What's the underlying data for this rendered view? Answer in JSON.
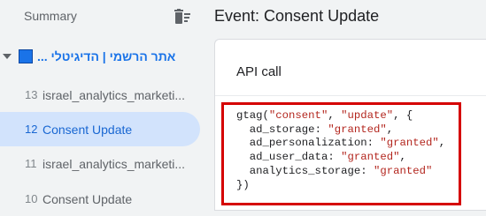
{
  "sidebar": {
    "summary_label": "Summary",
    "container_name": "אתר הרשמי | הדיגיטלי ...",
    "container_color": "#1a73e8",
    "events": [
      {
        "num": "13",
        "name": "israel_analytics_marketi...",
        "selected": false
      },
      {
        "num": "12",
        "name": "Consent Update",
        "selected": true
      },
      {
        "num": "11",
        "name": "israel_analytics_marketi...",
        "selected": false
      },
      {
        "num": "10",
        "name": "Consent Update",
        "selected": false
      }
    ]
  },
  "main": {
    "title": "Event: Consent Update",
    "card_title": "API call",
    "code": {
      "fn": "gtag(",
      "arg1": "\"consent\"",
      "arg2": "\"update\"",
      "open": ", {",
      "params": [
        {
          "key": "ad_storage",
          "value": "\"granted\""
        },
        {
          "key": "ad_personalization",
          "value": "\"granted\""
        },
        {
          "key": "ad_user_data",
          "value": "\"granted\""
        },
        {
          "key": "analytics_storage",
          "value": "\"granted\""
        }
      ],
      "close": "})"
    }
  },
  "colors": {
    "accent": "#1a73e8",
    "highlight_border": "#d50000",
    "string": "#b3261e",
    "selected_bg": "#d2e3fc"
  },
  "icons": {
    "delete": "delete-sweep-icon",
    "expand": "caret-down-icon"
  }
}
